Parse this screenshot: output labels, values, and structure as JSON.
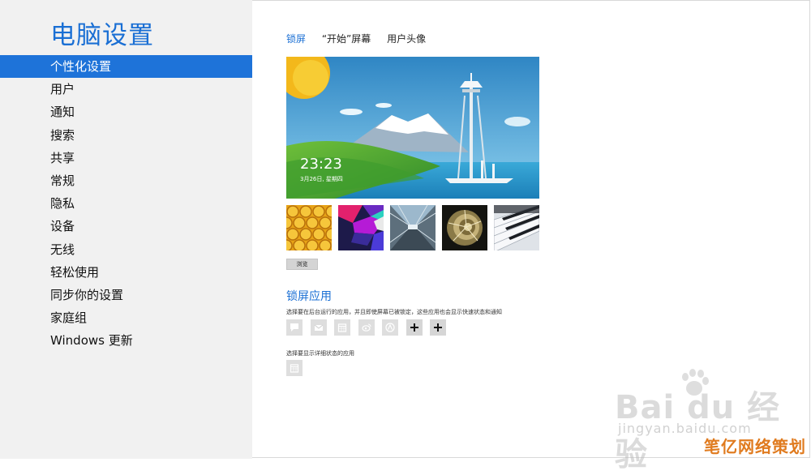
{
  "app": {
    "title": "电脑设置"
  },
  "nav": {
    "items": [
      {
        "label": "个性化设置",
        "selected": true
      },
      {
        "label": "用户"
      },
      {
        "label": "通知"
      },
      {
        "label": "搜索"
      },
      {
        "label": "共享"
      },
      {
        "label": "常规"
      },
      {
        "label": "隐私"
      },
      {
        "label": "设备"
      },
      {
        "label": "无线"
      },
      {
        "label": "轻松使用"
      },
      {
        "label": "同步你的设置"
      },
      {
        "label": "家庭组"
      },
      {
        "label": "Windows 更新"
      }
    ]
  },
  "tabs": [
    {
      "label": "锁屏",
      "active": true
    },
    {
      "label": "“开始”屏幕"
    },
    {
      "label": "用户头像"
    }
  ],
  "preview": {
    "time": "23:23",
    "date": "3月26日, 星期四"
  },
  "thumbnails": [
    {
      "icon": "honeycomb-image"
    },
    {
      "icon": "abstract-color-image"
    },
    {
      "icon": "tunnel-image"
    },
    {
      "icon": "nautilus-shell-image"
    },
    {
      "icon": "piano-keys-image"
    }
  ],
  "browse_button": {
    "label": "浏览"
  },
  "lock_apps": {
    "title": "锁屏应用",
    "description": "选择要在后台运行的应用，并且即使屏幕已被锁定，这些应用也会显示快速状态和通知",
    "slots": [
      {
        "icon": "messaging-icon"
      },
      {
        "icon": "mail-icon"
      },
      {
        "icon": "calendar-icon"
      },
      {
        "icon": "weibo-icon"
      },
      {
        "icon": "app-icon"
      },
      {
        "icon": "add-icon"
      },
      {
        "icon": "add-icon"
      }
    ],
    "detail_description": "选择要显示详细状态的应用",
    "detail_slot": {
      "icon": "calendar-icon"
    }
  },
  "watermark": {
    "logo": "Bai du 经验",
    "url": "jingyan.baidu.com",
    "brand": "笔亿网络策划"
  },
  "colors": {
    "accent": "#1e73d9",
    "sidebar_bg": "#f1f1f1",
    "brand_orange": "#e07b1f"
  }
}
